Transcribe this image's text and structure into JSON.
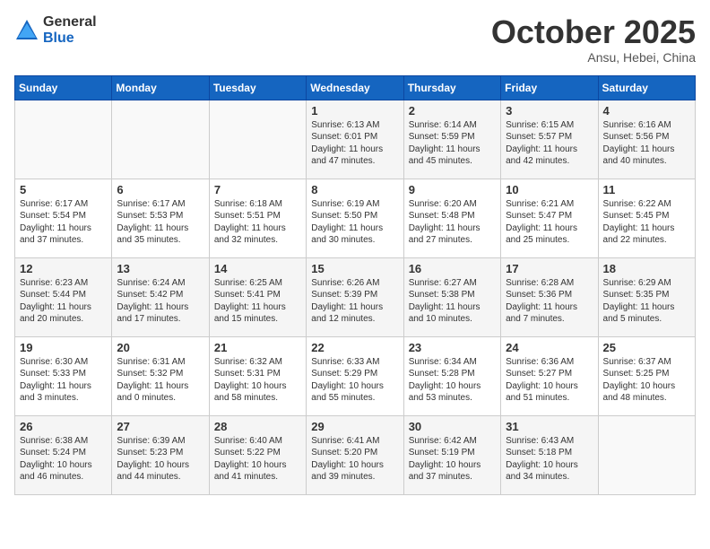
{
  "header": {
    "logo_general": "General",
    "logo_blue": "Blue",
    "month": "October 2025",
    "location": "Ansu, Hebei, China"
  },
  "weekdays": [
    "Sunday",
    "Monday",
    "Tuesday",
    "Wednesday",
    "Thursday",
    "Friday",
    "Saturday"
  ],
  "weeks": [
    [
      {
        "day": "",
        "text": ""
      },
      {
        "day": "",
        "text": ""
      },
      {
        "day": "",
        "text": ""
      },
      {
        "day": "1",
        "text": "Sunrise: 6:13 AM\nSunset: 6:01 PM\nDaylight: 11 hours\nand 47 minutes."
      },
      {
        "day": "2",
        "text": "Sunrise: 6:14 AM\nSunset: 5:59 PM\nDaylight: 11 hours\nand 45 minutes."
      },
      {
        "day": "3",
        "text": "Sunrise: 6:15 AM\nSunset: 5:57 PM\nDaylight: 11 hours\nand 42 minutes."
      },
      {
        "day": "4",
        "text": "Sunrise: 6:16 AM\nSunset: 5:56 PM\nDaylight: 11 hours\nand 40 minutes."
      }
    ],
    [
      {
        "day": "5",
        "text": "Sunrise: 6:17 AM\nSunset: 5:54 PM\nDaylight: 11 hours\nand 37 minutes."
      },
      {
        "day": "6",
        "text": "Sunrise: 6:17 AM\nSunset: 5:53 PM\nDaylight: 11 hours\nand 35 minutes."
      },
      {
        "day": "7",
        "text": "Sunrise: 6:18 AM\nSunset: 5:51 PM\nDaylight: 11 hours\nand 32 minutes."
      },
      {
        "day": "8",
        "text": "Sunrise: 6:19 AM\nSunset: 5:50 PM\nDaylight: 11 hours\nand 30 minutes."
      },
      {
        "day": "9",
        "text": "Sunrise: 6:20 AM\nSunset: 5:48 PM\nDaylight: 11 hours\nand 27 minutes."
      },
      {
        "day": "10",
        "text": "Sunrise: 6:21 AM\nSunset: 5:47 PM\nDaylight: 11 hours\nand 25 minutes."
      },
      {
        "day": "11",
        "text": "Sunrise: 6:22 AM\nSunset: 5:45 PM\nDaylight: 11 hours\nand 22 minutes."
      }
    ],
    [
      {
        "day": "12",
        "text": "Sunrise: 6:23 AM\nSunset: 5:44 PM\nDaylight: 11 hours\nand 20 minutes."
      },
      {
        "day": "13",
        "text": "Sunrise: 6:24 AM\nSunset: 5:42 PM\nDaylight: 11 hours\nand 17 minutes."
      },
      {
        "day": "14",
        "text": "Sunrise: 6:25 AM\nSunset: 5:41 PM\nDaylight: 11 hours\nand 15 minutes."
      },
      {
        "day": "15",
        "text": "Sunrise: 6:26 AM\nSunset: 5:39 PM\nDaylight: 11 hours\nand 12 minutes."
      },
      {
        "day": "16",
        "text": "Sunrise: 6:27 AM\nSunset: 5:38 PM\nDaylight: 11 hours\nand 10 minutes."
      },
      {
        "day": "17",
        "text": "Sunrise: 6:28 AM\nSunset: 5:36 PM\nDaylight: 11 hours\nand 7 minutes."
      },
      {
        "day": "18",
        "text": "Sunrise: 6:29 AM\nSunset: 5:35 PM\nDaylight: 11 hours\nand 5 minutes."
      }
    ],
    [
      {
        "day": "19",
        "text": "Sunrise: 6:30 AM\nSunset: 5:33 PM\nDaylight: 11 hours\nand 3 minutes."
      },
      {
        "day": "20",
        "text": "Sunrise: 6:31 AM\nSunset: 5:32 PM\nDaylight: 11 hours\nand 0 minutes."
      },
      {
        "day": "21",
        "text": "Sunrise: 6:32 AM\nSunset: 5:31 PM\nDaylight: 10 hours\nand 58 minutes."
      },
      {
        "day": "22",
        "text": "Sunrise: 6:33 AM\nSunset: 5:29 PM\nDaylight: 10 hours\nand 55 minutes."
      },
      {
        "day": "23",
        "text": "Sunrise: 6:34 AM\nSunset: 5:28 PM\nDaylight: 10 hours\nand 53 minutes."
      },
      {
        "day": "24",
        "text": "Sunrise: 6:36 AM\nSunset: 5:27 PM\nDaylight: 10 hours\nand 51 minutes."
      },
      {
        "day": "25",
        "text": "Sunrise: 6:37 AM\nSunset: 5:25 PM\nDaylight: 10 hours\nand 48 minutes."
      }
    ],
    [
      {
        "day": "26",
        "text": "Sunrise: 6:38 AM\nSunset: 5:24 PM\nDaylight: 10 hours\nand 46 minutes."
      },
      {
        "day": "27",
        "text": "Sunrise: 6:39 AM\nSunset: 5:23 PM\nDaylight: 10 hours\nand 44 minutes."
      },
      {
        "day": "28",
        "text": "Sunrise: 6:40 AM\nSunset: 5:22 PM\nDaylight: 10 hours\nand 41 minutes."
      },
      {
        "day": "29",
        "text": "Sunrise: 6:41 AM\nSunset: 5:20 PM\nDaylight: 10 hours\nand 39 minutes."
      },
      {
        "day": "30",
        "text": "Sunrise: 6:42 AM\nSunset: 5:19 PM\nDaylight: 10 hours\nand 37 minutes."
      },
      {
        "day": "31",
        "text": "Sunrise: 6:43 AM\nSunset: 5:18 PM\nDaylight: 10 hours\nand 34 minutes."
      },
      {
        "day": "",
        "text": ""
      }
    ]
  ]
}
